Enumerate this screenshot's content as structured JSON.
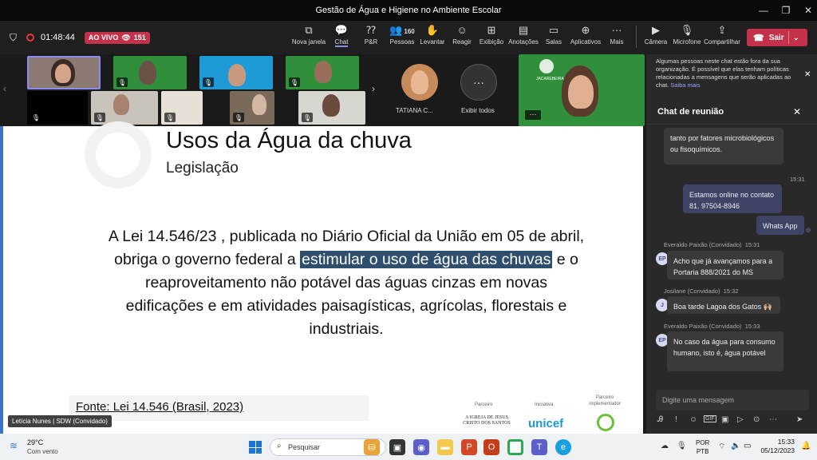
{
  "window": {
    "title": "Gestão de Água e Higiene no Ambiente Escolar"
  },
  "meeting": {
    "timer": "01:48:44",
    "live_label": "AO VIVO",
    "viewers": "151",
    "people_count": "160"
  },
  "toolbar": {
    "buttons": [
      "Nova janela",
      "Chat",
      "P&R",
      "Pessoas",
      "Levantar",
      "Reagir",
      "Exibição",
      "Anotações",
      "Salas",
      "Aplicativos",
      "Mais",
      "Câmera",
      "Microfone",
      "Compartilhar"
    ],
    "leave_label": "Sair"
  },
  "participants": {
    "tatiana_label": "TATIANA C...",
    "show_all_label": "Exibir todos",
    "brand_text": "INSTITUTO JACAREHUB",
    "ibi_text": "JACAREBEIRA"
  },
  "slide": {
    "title": "Usos da Água da chuva",
    "subtitle": "Legislação",
    "body_before": "A Lei 14.546/23 , publicada no Diário Oficial da União em 05 de abril, obriga o governo federal a ",
    "body_highlight": "estimular o uso de água das chuvas",
    "body_after": " e o reaproveitamento não potável das águas cinzas em novas edificações e em atividades paisagísticas, agrícolas, florestais e industriais.",
    "source": "Fonte: Lei 14.546 (Brasil, 2023)",
    "partners": {
      "p1_label": "Parceiro",
      "p1_name": "A IGREJA DE JESUS CRISTO DOS SANTOS",
      "p2_label": "Iniciativa",
      "p2_name": "unicef",
      "p3_label": "Parceiro implementador"
    },
    "presenter": "Letícia Nunes | SDW (Convidado)"
  },
  "chat": {
    "notice": "Algumas pessoas neste chat estão fora da sua organização. É possível que elas tenham políticas relacionadas a mensagens que serão aplicadas ao chat.",
    "notice_link": "Saiba mais",
    "title": "Chat de reunião",
    "messages": [
      {
        "text": "tanto por fatores microbiológicos ou fisoquímicos.",
        "time": ""
      },
      {
        "time": "15:31",
        "text": "Estamos online no contato 81. 97504-8946"
      },
      {
        "text": "Whats App"
      },
      {
        "author": "Everaldo Paixão (Convidado)",
        "time": "15:31",
        "initials": "EP",
        "text": "Acho que já avançamos para a Portaria 888/2021 do MS"
      },
      {
        "author": "Josilane (Convidado)",
        "time": "15:32",
        "initials": "J",
        "text": "Boa tarde Lagoa dos Gatos 🙌🏼"
      },
      {
        "author": "Everaldo Paixão (Convidado)",
        "time": "15:33",
        "initials": "EP",
        "text": "No caso da água para consumo humano, isto é, água potável"
      }
    ],
    "input_placeholder": "Digite uma mensagem"
  },
  "taskbar": {
    "temperature": "29°C",
    "weather": "Com vento",
    "search_placeholder": "Pesquisar",
    "lang": "POR",
    "layout": "PTB",
    "time": "15:33",
    "date": "05/12/2023"
  }
}
